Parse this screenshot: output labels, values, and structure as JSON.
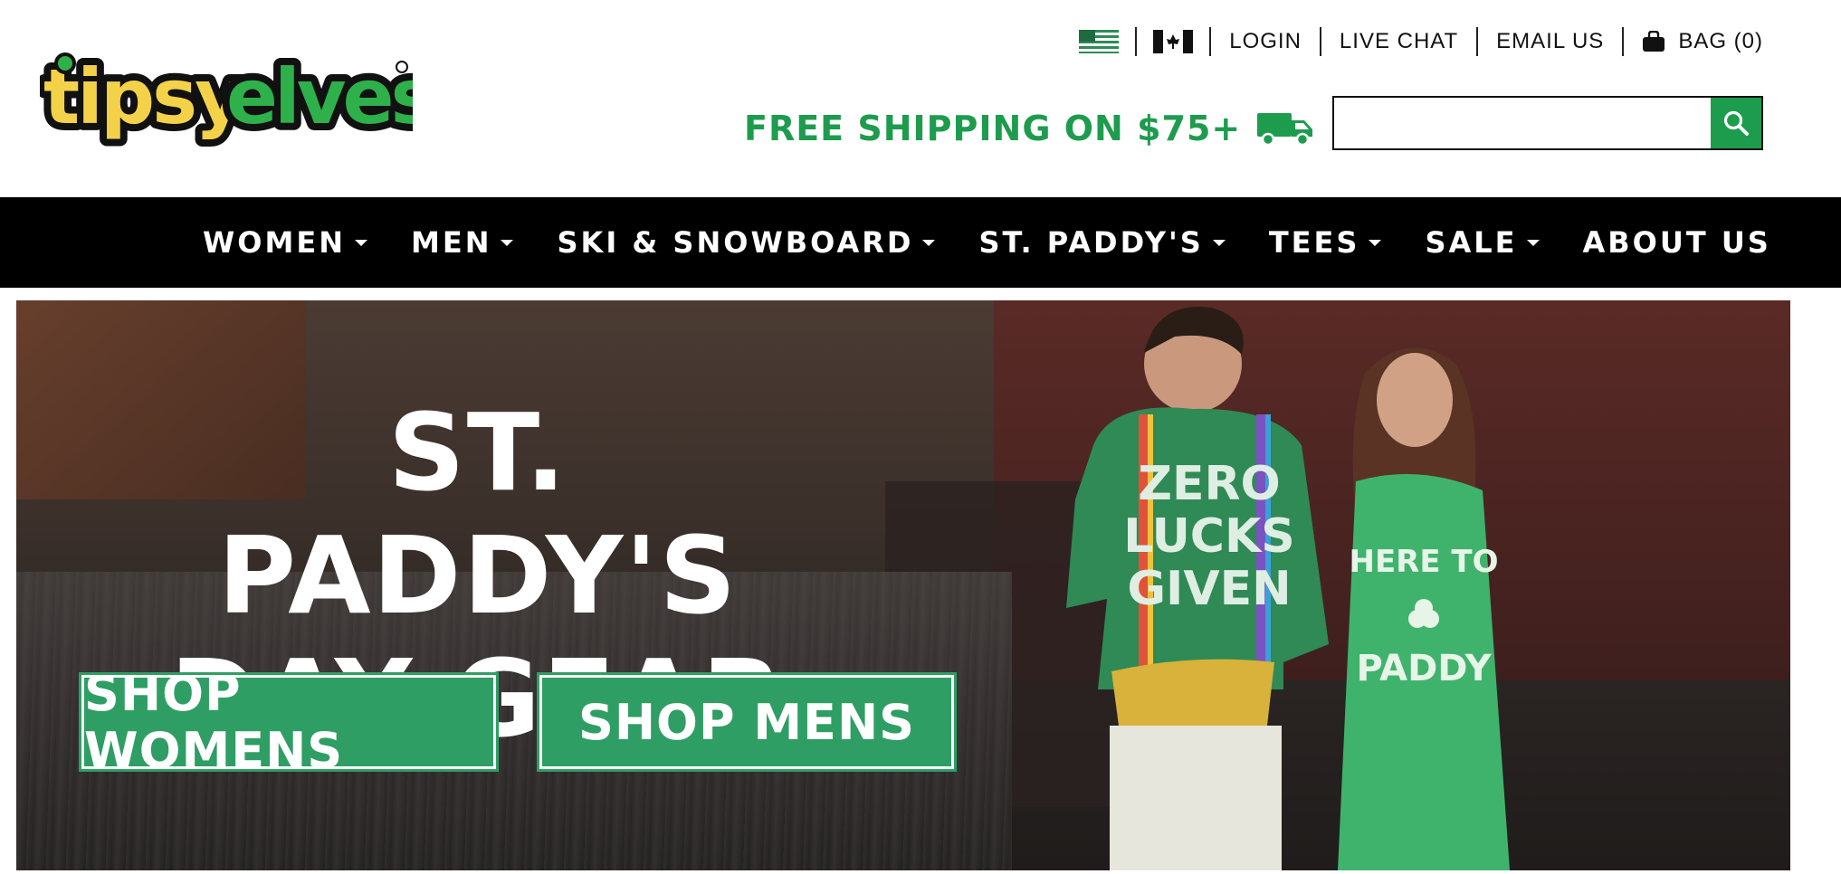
{
  "brand": {
    "logo_text": "tipsyelves",
    "colors": {
      "green": "#1e9c4e",
      "yellow": "#f3d24a",
      "cta_green": "#2f9e64"
    }
  },
  "utility_nav": {
    "flags": [
      "us-flag-icon",
      "canada-flag-icon"
    ],
    "links": [
      {
        "label": "LOGIN"
      },
      {
        "label": "LIVE CHAT"
      },
      {
        "label": "EMAIL US"
      }
    ],
    "bag_label": "BAG (0)"
  },
  "promo": {
    "shipping_text": "FREE SHIPPING ON $75+"
  },
  "search": {
    "value": "",
    "placeholder": ""
  },
  "main_nav": [
    {
      "label": "WOMEN",
      "has_dropdown": true
    },
    {
      "label": "MEN",
      "has_dropdown": true
    },
    {
      "label": "SKI & SNOWBOARD",
      "has_dropdown": true
    },
    {
      "label": "ST. PADDY'S",
      "has_dropdown": true
    },
    {
      "label": "TEES",
      "has_dropdown": true
    },
    {
      "label": "SALE",
      "has_dropdown": true
    },
    {
      "label": "ABOUT US",
      "has_dropdown": false
    }
  ],
  "hero": {
    "headline_line1": "ST. PADDY'S",
    "headline_line2": "DAY GEAR",
    "cta_women": "SHOP WOMENS",
    "cta_men": "SHOP MENS",
    "shirt_text_men": [
      "ZERO",
      "LUCKS",
      "GIVEN"
    ],
    "shirt_text_women": [
      "HERE TO",
      "PADDY"
    ]
  }
}
